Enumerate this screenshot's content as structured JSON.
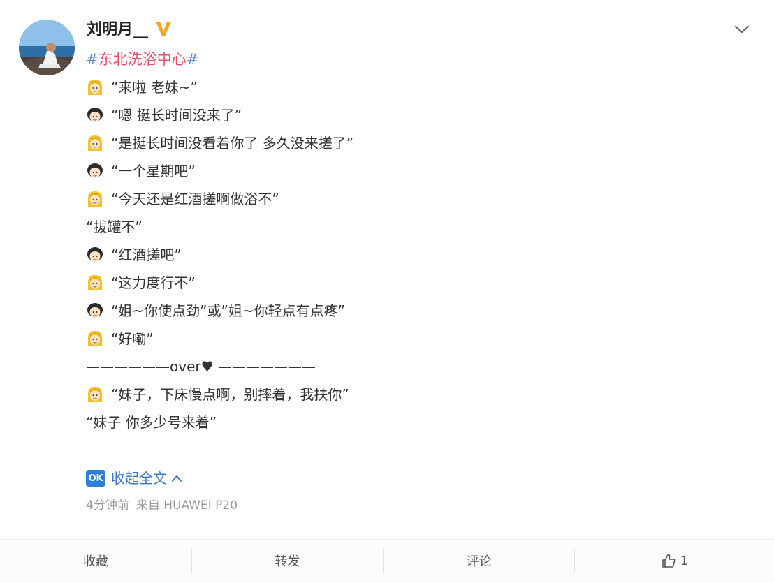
{
  "author": {
    "name": "刘明月__",
    "verified_icon": "verified-v-icon",
    "verified_color": "#f5a623"
  },
  "post": {
    "hashtag_prefix": "#",
    "hashtag_text": "东北洗浴中心",
    "hashtag_suffix": "#",
    "lines": [
      "“来啦 老妹~”",
      "“嗯 挺长时间没来了”",
      "“是挺长时间没看着你了 多久没来搓了”",
      "“一个星期吧”",
      "“今天还是红酒搓啊做浴不”",
      "“拔罐不”",
      "“红酒搓吧”",
      "“这力度行不”",
      "“姐~你使点劲”或”姐~你轻点有点疼”",
      "“好嘞”",
      "——————over♥ ———————",
      "“妹子，下床慢点啊，别摔着，我扶你”",
      "“妹子 你多少号来着”"
    ],
    "line_icons": [
      "blonde-girl-emoji",
      "dark-hair-girl-emoji",
      "blonde-girl-emoji",
      "dark-hair-girl-emoji",
      "blonde-girl-emoji",
      "",
      "dark-hair-girl-emoji",
      "blonde-girl-emoji",
      "dark-hair-girl-emoji",
      "blonde-girl-emoji",
      "",
      "blonde-girl-emoji",
      ""
    ],
    "ok_badge": "OK",
    "collapse_label": "收起全文",
    "time": "4分钟前",
    "source": "来自 HUAWEI P20"
  },
  "actions": {
    "favorite": "收藏",
    "repost": "转发",
    "comment": "评论",
    "like_count": "1"
  },
  "colors": {
    "hashtag_hash": "#5e8fc7",
    "hashtag_text": "#e8506a",
    "link_blue": "#3a79c7",
    "meta_gray": "#9b9b9b"
  }
}
